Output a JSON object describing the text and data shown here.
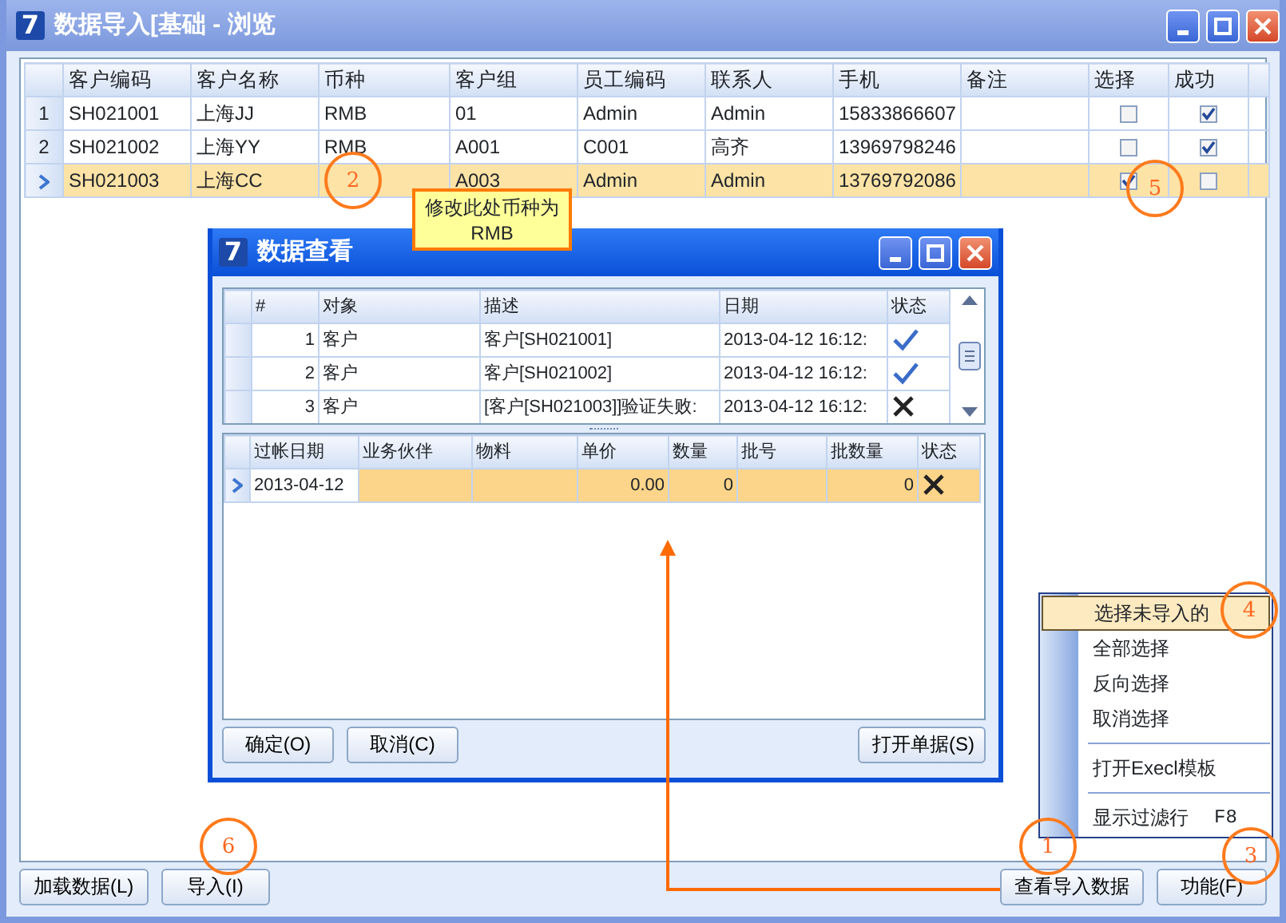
{
  "window": {
    "logo": "7",
    "title": "数据导入[基础 - 浏览"
  },
  "main_table": {
    "columns": [
      "客户编码",
      "客户名称",
      "币种",
      "客户组",
      "员工编码",
      "联系人",
      "手机",
      "备注",
      "选择",
      "成功"
    ],
    "rows": [
      {
        "index": "1",
        "selected": false,
        "cells": [
          "SH021001",
          "上海JJ",
          "RMB",
          "01",
          "Admin",
          "Admin",
          "15833866607"
        ],
        "chosen": false,
        "success": true
      },
      {
        "index": "2",
        "selected": false,
        "cells": [
          "SH021002",
          "上海YY",
          "RMB",
          "A001",
          "C001",
          "高齐",
          "13969798246"
        ],
        "chosen": false,
        "success": true
      },
      {
        "selected": true,
        "cells": [
          "SH021003",
          "上海CC",
          null,
          "A003",
          "Admin",
          "Admin",
          "13769792086"
        ],
        "chosen": true,
        "success": false
      }
    ]
  },
  "bottom_buttons": [
    {
      "label": "加载数据(L)"
    },
    {
      "label": "导入(I)"
    },
    {
      "label": "查看导入数据"
    },
    {
      "label": "功能(F)"
    }
  ],
  "dialog": {
    "logo": "7",
    "title": "数据查看",
    "log_table": {
      "columns": [
        "#",
        "对象",
        "描述",
        "日期",
        "状态"
      ],
      "rows": [
        {
          "number": "1",
          "object": "客户",
          "description": "客户[SH021001]",
          "date": "2013-04-12 16:12:",
          "passed": true
        },
        {
          "number": "2",
          "object": "客户",
          "description": "客户[SH021002]",
          "date": "2013-04-12 16:12:",
          "passed": true
        },
        {
          "number": "3",
          "object": "客户",
          "description": "[客户[SH021003]]验证失败:",
          "date": "2013-04-12 16:12:",
          "passed": false
        }
      ]
    },
    "detail_table": {
      "columns": [
        "过帐日期",
        "业务伙伴",
        "物料",
        "单价",
        "数量",
        "批号",
        "批数量",
        "状态"
      ],
      "rows": [
        {
          "selected": true,
          "cells": [
            "2013-04-12",
            null,
            null,
            "0.00",
            "0",
            null,
            "0"
          ],
          "passed": false
        }
      ]
    },
    "buttons": [
      {
        "label": "确定(O)"
      },
      {
        "label": "取消(C)"
      },
      {
        "label": "打开单据(S)"
      }
    ]
  },
  "context_menu": [
    {
      "kind": "item",
      "label": "选择未导入的",
      "selected": true
    },
    {
      "kind": "item",
      "label": "全部选择",
      "selected": false
    },
    {
      "kind": "item",
      "label": "反向选择",
      "selected": false
    },
    {
      "kind": "item",
      "label": "取消选择",
      "selected": false
    },
    {
      "kind": "separator"
    },
    {
      "kind": "item",
      "label": "打开Execl模板",
      "selected": false
    },
    {
      "kind": "separator"
    },
    {
      "kind": "item",
      "label": "显示过滤行",
      "shortcut": "F8",
      "selected": false
    }
  ],
  "annotations": {
    "markers": [
      "2",
      "5",
      "4",
      "6",
      "1",
      "3"
    ],
    "callout": "修改此处币种为RMB"
  }
}
